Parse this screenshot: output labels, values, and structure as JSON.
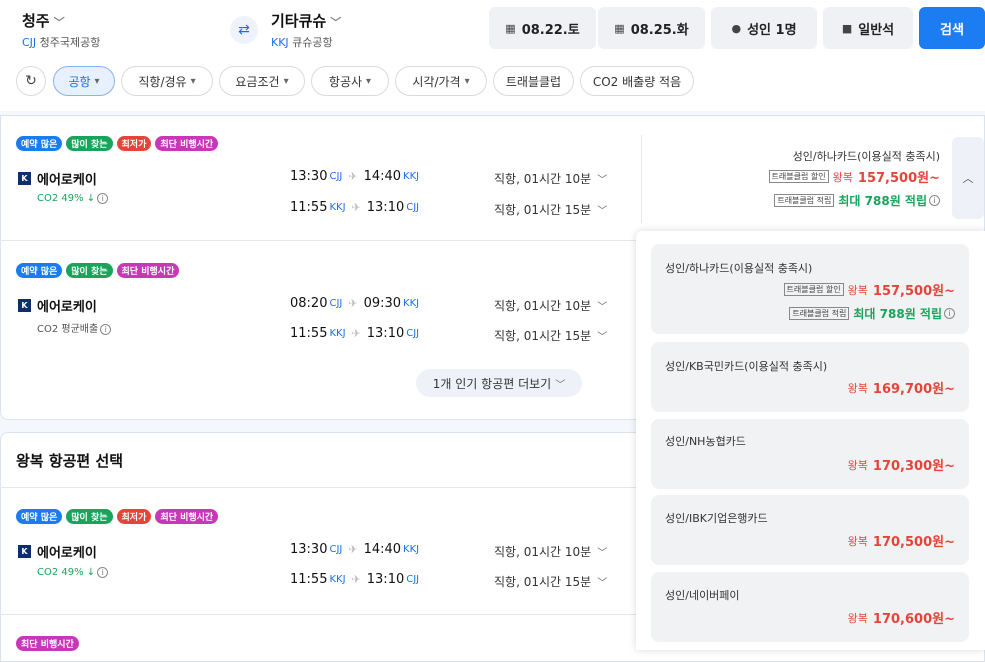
{
  "header": {
    "from": {
      "city": "청주",
      "code": "CJJ",
      "airport": "청주국제공항"
    },
    "to": {
      "city": "기타큐슈",
      "code": "KKJ",
      "airport": "큐슈공항"
    },
    "date_out": "08.22.토",
    "date_in": "08.25.화",
    "passengers": "성인 1명",
    "cabin": "일반석",
    "search": "검색"
  },
  "filters": [
    {
      "label": "공항",
      "active": true
    },
    {
      "label": "직항/경유"
    },
    {
      "label": "요금조건"
    },
    {
      "label": "항공사"
    },
    {
      "label": "시각/가격"
    },
    {
      "label": "트래블클럽"
    },
    {
      "label": "CO2 배출량 적음"
    }
  ],
  "badge_labels": {
    "reserve": "예약 많은",
    "popular": "많이 찾는",
    "cheapest": "최저가",
    "shortest": "최단 비행시간"
  },
  "flights": [
    {
      "airline": "에어로케이",
      "co2": "CO2 49% ↓",
      "legs": [
        {
          "dep": "13:30",
          "dep_code": "CJJ",
          "arr": "14:40",
          "arr_code": "KKJ",
          "dur": "직항, 01시간 10분"
        },
        {
          "dep": "11:55",
          "dep_code": "KKJ",
          "arr": "13:10",
          "arr_code": "CJJ",
          "dur": "직항, 01시간 15분"
        }
      ],
      "price": {
        "label": "성인/하나카드(이용실적 충족시)",
        "tag1": "트래블클럽 할인",
        "round": "왕복",
        "amount": "157,500원~",
        "tag2": "트래블클럽 적립",
        "points": "최대 788원 적립"
      }
    },
    {
      "airline": "에어로케이",
      "co2": "CO2 평균배출",
      "legs": [
        {
          "dep": "08:20",
          "dep_code": "CJJ",
          "arr": "09:30",
          "arr_code": "KKJ",
          "dur": "직항, 01시간 10분"
        },
        {
          "dep": "11:55",
          "dep_code": "KKJ",
          "arr": "13:10",
          "arr_code": "CJJ",
          "dur": "직항, 01시간 15분"
        }
      ]
    },
    {
      "airline": "에어로케이",
      "co2": "CO2 49% ↓",
      "legs": [
        {
          "dep": "13:30",
          "dep_code": "CJJ",
          "arr": "14:40",
          "arr_code": "KKJ",
          "dur": "직항, 01시간 10분"
        },
        {
          "dep": "11:55",
          "dep_code": "KKJ",
          "arr": "13:10",
          "arr_code": "CJJ",
          "dur": "직항, 01시간 15분"
        }
      ]
    }
  ],
  "more_button": "1개 인기 항공편 더보기",
  "section_title": "왕복 항공편 선택",
  "dropdown": [
    {
      "name": "성인/하나카드(이용실적 충족시)",
      "tag1": "트래블클럽 할인",
      "round": "왕복",
      "amount": "157,500원~",
      "tag2": "트래블클럽 적립",
      "points": "최대 788원 적립"
    },
    {
      "name": "성인/KB국민카드(이용실적 충족시)",
      "round": "왕복",
      "amount": "169,700원~"
    },
    {
      "name": "성인/NH농협카드",
      "round": "왕복",
      "amount": "170,300원~"
    },
    {
      "name": "성인/IBK기업은행카드",
      "round": "왕복",
      "amount": "170,500원~"
    },
    {
      "name": "성인/네이버페이",
      "round": "왕복",
      "amount": "170,600원~"
    }
  ],
  "colors": {
    "accent": "#1c7cf2",
    "price": "#e5443a",
    "green": "#18a45b",
    "purple": "#c738b8"
  },
  "icons": {
    "calendar": "calendar-icon",
    "person": "person-icon",
    "seat": "seat-icon",
    "swap": "swap-icon",
    "refresh": "refresh-icon",
    "plane": "plane-icon",
    "info": "info-icon"
  }
}
